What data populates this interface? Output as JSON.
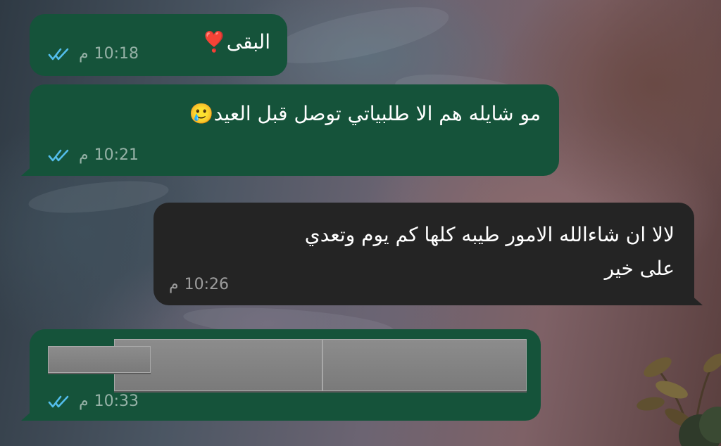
{
  "messages": [
    {
      "id": "m1",
      "direction": "outgoing",
      "text": "البقى",
      "emoji": "❣️",
      "time": "10:18",
      "ampm": "م",
      "status": "read"
    },
    {
      "id": "m2",
      "direction": "outgoing",
      "text": "مو شايله هم الا طلبياتي توصل قبل العيد",
      "emoji": "🥲",
      "time": "10:21",
      "ampm": "م",
      "status": "read"
    },
    {
      "id": "m3",
      "direction": "incoming",
      "line1": "لالا ان شاءالله الامور طيبه كلها كم يوم وتعدي",
      "line2": "على خير",
      "time": "10:26",
      "ampm": "م"
    },
    {
      "id": "m4",
      "direction": "outgoing",
      "text": "",
      "redacted": true,
      "time": "10:33",
      "ampm": "م",
      "status": "read"
    }
  ],
  "colors": {
    "outgoing_bubble": "#15533a",
    "incoming_bubble": "#242424",
    "read_ticks": "#53bdeb"
  },
  "icons": {
    "read_status": "double-check-icon"
  }
}
